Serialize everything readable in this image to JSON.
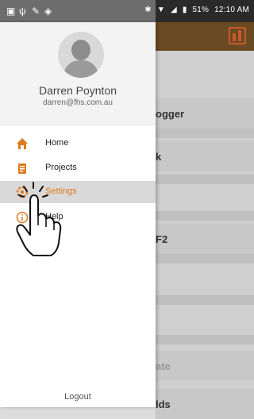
{
  "status_bar": {
    "battery": "51%",
    "time": "12:10 AM"
  },
  "drawer": {
    "user": {
      "name": "Darren Poynton",
      "email": "darren@fhs.com.au"
    },
    "menu": [
      {
        "label": "Home",
        "icon": "home-icon"
      },
      {
        "label": "Projects",
        "icon": "projects-icon"
      },
      {
        "label": "Settings",
        "icon": "settings-icon",
        "active": true
      },
      {
        "label": "Help",
        "icon": "info-icon"
      }
    ],
    "logout_label": "Logout"
  },
  "background_content": {
    "items": [
      "ogger",
      "k",
      "F2",
      "ate",
      "lds"
    ]
  },
  "colors": {
    "accent": "#e07a20",
    "app_bar": "#6a4a22"
  }
}
